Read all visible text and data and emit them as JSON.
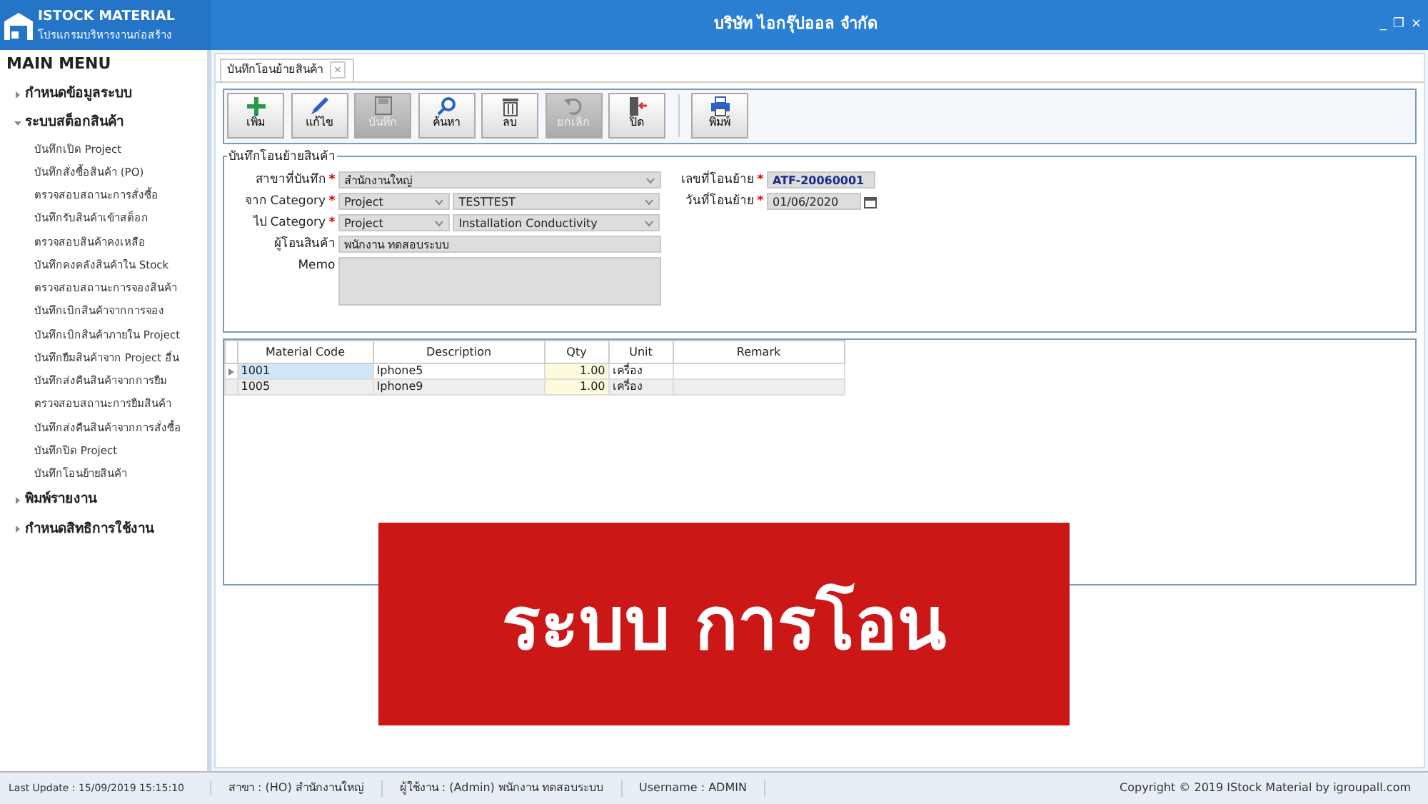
{
  "app": {
    "title": "ISTOCK MATERIAL",
    "subtitle": "โปรแกรมบริหารงานก่อสร้าง",
    "company": "บริษัท ไอกรุ๊ปออล จำกัด",
    "controls": [
      "_",
      "❐",
      "×"
    ]
  },
  "sidebar": {
    "title": "MAIN MENU",
    "items": [
      {
        "label": "กำหนดข้อมูลระบบ",
        "expanded": false
      },
      {
        "label": "ระบบสต็อกสินค้า",
        "expanded": true,
        "children": [
          {
            "label": "บันทึกเปิด Project"
          },
          {
            "label": "บันทึกสั่งซื้อสินค้า (PO)"
          },
          {
            "label": "ตรวจสอบสถานะการสั่งซื้อ"
          },
          {
            "label": "บันทึกรับสินค้าเข้าสต็อก"
          },
          {
            "label": "ตรวจสอบสินค้าคงเหลือ"
          },
          {
            "label": "บันทึกคงคลังสินค้าใน Stock"
          },
          {
            "label": "ตรวจสอบสถานะการจองสินค้า"
          },
          {
            "label": "บันทึกเบิกสินค้าจากการจอง"
          },
          {
            "label": "บันทึกเบิกสินค้าภายใน Project"
          },
          {
            "label": "บันทึกยืมสินค้าจาก Project อื่น"
          },
          {
            "label": "บันทึกส่งคืนสินค้าจากการยืม"
          },
          {
            "label": "ตรวจสอบสถานะการยืมสินค้า"
          },
          {
            "label": "บันทึกส่งคืนสินค้าจากการสั่งซื้อ"
          },
          {
            "label": "บันทึกปิด Project"
          },
          {
            "label": "บันทึกโอนย้ายสินค้า"
          }
        ]
      },
      {
        "label": "พิมพ์รายงาน",
        "expanded": false
      },
      {
        "label": "กำหนดสิทธิการใช้งาน",
        "expanded": false
      }
    ]
  },
  "tabs": [
    {
      "label": "บันทึกโอนย้ายสินค้า",
      "close": "×",
      "selected": true
    }
  ],
  "toolbar": [
    {
      "kind": "add",
      "label": "เพิ่ม",
      "disabled": false
    },
    {
      "kind": "edit",
      "label": "แก้ไข",
      "disabled": false
    },
    {
      "kind": "save",
      "label": "บันทึก",
      "disabled": true
    },
    {
      "kind": "search",
      "label": "ค้นหา",
      "disabled": false
    },
    {
      "kind": "delete",
      "label": "ลบ",
      "disabled": false
    },
    {
      "kind": "undo",
      "label": "ยกเลิก",
      "disabled": true
    },
    {
      "kind": "exit",
      "label": "ปิด",
      "disabled": false
    },
    {
      "kind": "print",
      "label": "พิมพ์",
      "disabled": false
    }
  ],
  "form": {
    "legend": "บันทึกโอนย้ายสินค้า",
    "branch": {
      "label": "สาขาที่บันทึก",
      "required_mark": "*",
      "value": "สำนักงานใหญ่"
    },
    "from": {
      "label": "จาก Category",
      "required_mark": "*",
      "value": "Project",
      "value2": "TESTTEST"
    },
    "to": {
      "label": "ไป Category",
      "required_mark": "*",
      "value": "Project",
      "value2": "Installation Conductivity"
    },
    "sender": {
      "label": "ผู้โอนสินค้า",
      "value": "พนักงาน ทดสอบระบบ"
    },
    "memo": {
      "label": "Memo"
    },
    "doc_no": {
      "label": "เลขที่โอนย้าย",
      "required_mark": "*",
      "value": "ATF-20060001"
    },
    "doc_date": {
      "label": "วันที่โอนย้าย",
      "required_mark": "*",
      "value": "01/06/2020"
    }
  },
  "table": {
    "columns": [
      "Material Code",
      "Description",
      "Qty",
      "Unit",
      "Remark"
    ],
    "rows": [
      {
        "cells": [
          "1001",
          "Iphone5",
          "1.00",
          "เครื่อง",
          ""
        ],
        "selected": true
      },
      {
        "cells": [
          "1005",
          "Iphone9",
          "1.00",
          "เครื่อง",
          ""
        ],
        "selected": false
      }
    ]
  },
  "overlay_banner": "ระบบ การโอน",
  "status_bar": [
    "Last Update : 15/09/2019 15:15:10",
    "สาขา : (HO) สำนักงานใหญ่",
    "ผู้ใช้งาน : (Admin) พนักงาน ทดสอบระบบ",
    "Username : ADMIN",
    "Copyright © 2019 IStock Material by igroupall.com"
  ]
}
